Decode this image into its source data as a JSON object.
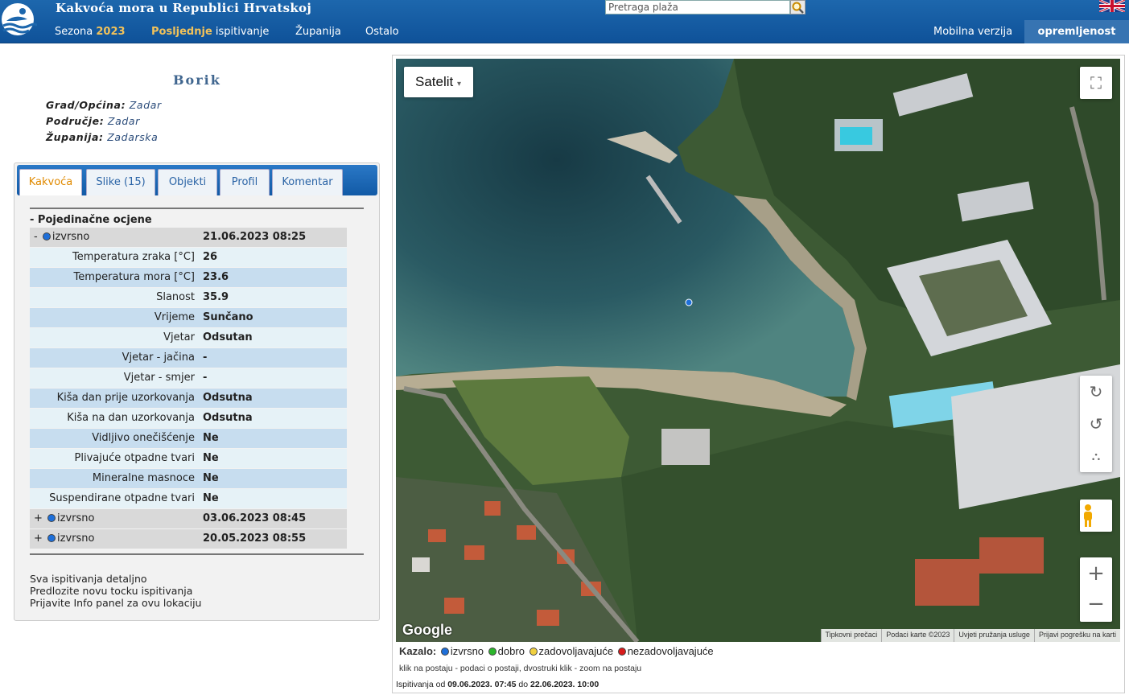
{
  "header": {
    "title": "Kakvoća mora u Republici Hrvatskoj",
    "search_placeholder": "Pretraga plaža",
    "nav": {
      "sezona_label": "Sezona",
      "sezona_year": "2023",
      "posljednje_hl": "Posljednje",
      "posljednje_rest": "ispitivanje",
      "zupanija": "Županija",
      "ostalo": "Ostalo",
      "mobile": "Mobilna verzija",
      "oprem": "opremljenost"
    }
  },
  "beach": {
    "name": "Borik",
    "grad_label": "Grad/Općina:",
    "grad": "Zadar",
    "podrucje_label": "Područje:",
    "podrucje": "Zadar",
    "zupanija_label": "Županija:",
    "zupanija": "Zadarska"
  },
  "tabs": [
    "Kakvoća",
    "Slike (15)",
    "Objekti",
    "Profil",
    "Komentar"
  ],
  "assessment": {
    "section_title": "- Pojedinačne ocjene",
    "latest": {
      "toggle": "-",
      "status": "izvrsno",
      "datetime": "21.06.2023 08:25"
    },
    "params": [
      {
        "label": "Temperatura zraka [°C]",
        "value": "26"
      },
      {
        "label": "Temperatura mora [°C]",
        "value": "23.6"
      },
      {
        "label": "Slanost",
        "value": "35.9"
      },
      {
        "label": "Vrijeme",
        "value": "Sunčano"
      },
      {
        "label": "Vjetar",
        "value": "Odsutan"
      },
      {
        "label": "Vjetar - jačina",
        "value": "-"
      },
      {
        "label": "Vjetar - smjer",
        "value": "-"
      },
      {
        "label": "Kiša dan prije uzorkovanja",
        "value": "Odsutna"
      },
      {
        "label": "Kiša na dan uzorkovanja",
        "value": "Odsutna"
      },
      {
        "label": "Vidljivo onečišćenje",
        "value": "Ne"
      },
      {
        "label": "Plivajuće otpadne tvari",
        "value": "Ne"
      },
      {
        "label": "Mineralne masnoce",
        "value": "Ne"
      },
      {
        "label": "Suspendirane otpadne tvari",
        "value": "Ne"
      }
    ],
    "older": [
      {
        "toggle": "+",
        "status": "izvrsno",
        "datetime": "03.06.2023 08:45"
      },
      {
        "toggle": "+",
        "status": "izvrsno",
        "datetime": "20.05.2023 08:55"
      }
    ],
    "links": [
      "Sva ispitivanja detaljno",
      "Predlozite novu tocku ispitivanja",
      "Prijavite Info panel za ovu lokaciju"
    ]
  },
  "map": {
    "type_label": "Satelit",
    "logo": "Google",
    "attribution": [
      "Tipkovni prečaci",
      "Podaci karte ©2023",
      "Uvjeti pružanja usluge",
      "Prijavi pogrešku na karti"
    ],
    "legend_title": "Kazalo:",
    "legend": [
      {
        "label": "izvrsno",
        "color": "#1e6fd9"
      },
      {
        "label": "dobro",
        "color": "#2bb52b"
      },
      {
        "label": "zadovoljavajuće",
        "color": "#f0d040"
      },
      {
        "label": "nezadovoljavajuće",
        "color": "#d81b1b"
      }
    ],
    "hint": "klik na postaju - podaci o postaji, dvostruki klik - zoom na postaju",
    "period_prefix": "Ispitivanja od",
    "period_from": "09.06.2023. 07:45",
    "period_mid": "do",
    "period_to": "22.06.2023. 10:00"
  },
  "colors": {
    "status_excellent": "#1e6fd9",
    "header_blue": "#125aa6",
    "accent_orange": "#e08a00"
  }
}
